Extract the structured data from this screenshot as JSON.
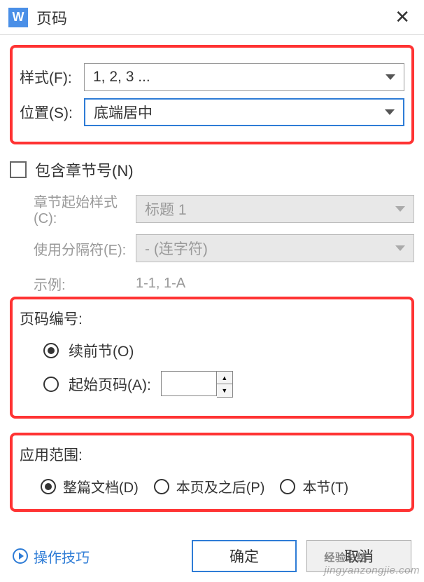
{
  "titlebar": {
    "title": "页码"
  },
  "style_section": {
    "format_label": "样式(F):",
    "format_value": "1, 2, 3 ...",
    "position_label": "位置(S):",
    "position_value": "底端居中"
  },
  "chapter": {
    "include_label": "包含章节号(N)",
    "start_style_label": "章节起始样式(C):",
    "start_style_value": "标题 1",
    "separator_label": "使用分隔符(E):",
    "separator_value": "-    (连字符)",
    "example_label": "示例:",
    "example_value": "1-1, 1-A"
  },
  "numbering": {
    "title": "页码编号:",
    "continue_label": "续前节(O)",
    "start_at_label": "起始页码(A):",
    "start_at_value": ""
  },
  "scope": {
    "title": "应用范围:",
    "whole_doc_label": "整篇文档(D)",
    "from_here_label": "本页及之后(P)",
    "this_section_label": "本节(T)"
  },
  "footer": {
    "tips_label": "操作技巧",
    "ok_label": "确定",
    "cancel_label": "取消"
  },
  "watermark": {
    "cn": "经验总结",
    "url": "jingyanzongjie.com"
  }
}
